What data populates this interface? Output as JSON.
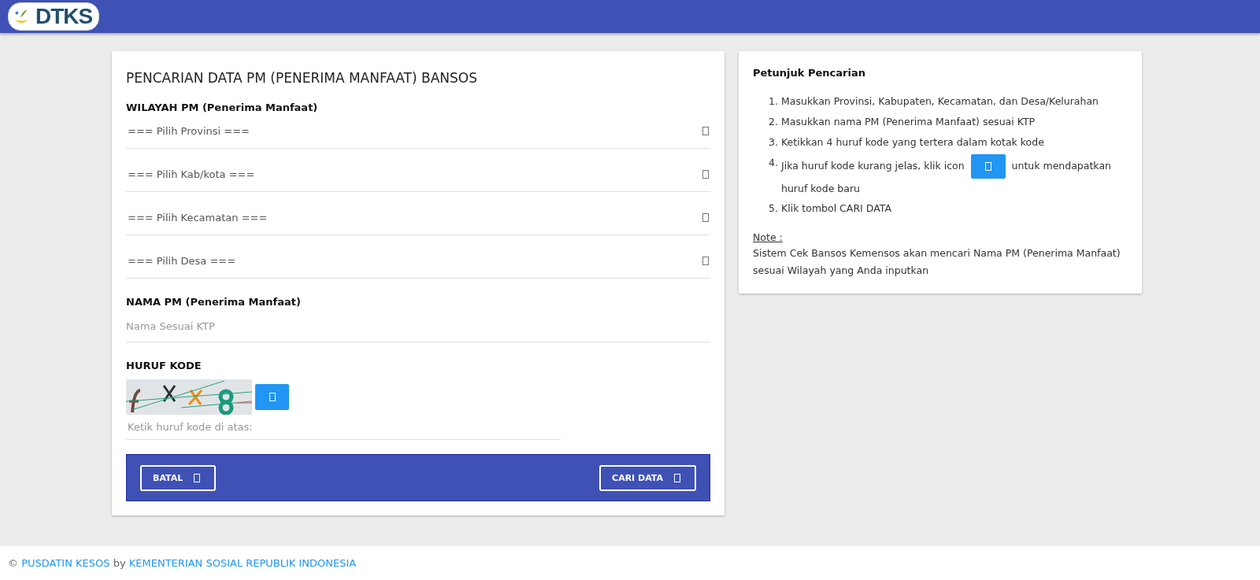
{
  "header": {
    "logo_text": "DTKS"
  },
  "search_form": {
    "title": "PENCARIAN DATA PM (PENERIMA MANFAAT) BANSOS",
    "region_label": "WILAYAH PM (Penerima Manfaat)",
    "selects": [
      {
        "placeholder": "=== Pilih Provinsi ==="
      },
      {
        "placeholder": "=== Pilih Kab/kota ==="
      },
      {
        "placeholder": "=== Pilih Kecamatan ==="
      },
      {
        "placeholder": "=== Pilih Desa ==="
      }
    ],
    "name_label": "NAMA PM (Penerima Manfaat)",
    "name_input": {
      "placeholder": "Nama Sesuai KTP"
    },
    "code_label": "HURUF KODE",
    "code_input": {
      "placeholder": "Ketik huruf kode di atas:"
    },
    "buttons": [
      {
        "label": "BATAL"
      },
      {
        "label": "CARI DATA"
      }
    ]
  },
  "instructions": {
    "title": "Petunjuk Pencarian",
    "steps": [
      {
        "number": "1.",
        "kind": "text",
        "text": "Masukkan Provinsi, Kabupaten, Kecamatan, dan Desa/Kelurahan"
      },
      {
        "number": "2.",
        "kind": "text",
        "text": "Masukkan nama PM (Penerima Manfaat) sesuai KTP"
      },
      {
        "number": "3.",
        "kind": "text",
        "text": "Ketikkan 4 huruf kode yang tertera dalam kotak kode"
      },
      {
        "number": "4.",
        "kind": "with_button",
        "text": "Jika huruf kode kurang jelas, klik icon",
        "text_after": "untuk mendapatkan",
        "text_line2": "huruf kode baru"
      },
      {
        "number": "5.",
        "kind": "text",
        "text": "Klik tombol CARI DATA"
      }
    ],
    "note_label": "Note :",
    "note_text": "Sistem Cek Bansos Kemensos akan mencari Nama PM (Penerima Manfaat) sesuai Wilayah yang Anda inputkan"
  },
  "footer": {
    "copyright": "©",
    "org_link": "PUSDATIN KESOS",
    "by": "by",
    "ministry_link": "KEMENTERIAN SOSIAL REPUBLIK INDONESIA"
  }
}
